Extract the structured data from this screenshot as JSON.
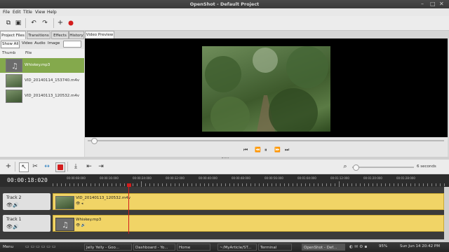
{
  "window": {
    "title": "OpenShot - Default Project"
  },
  "menu": [
    "File",
    "Edit",
    "Title",
    "View",
    "Help"
  ],
  "left_tabs": [
    "Project Files",
    "Transitions",
    "Effects",
    "History"
  ],
  "filters": [
    "Show All",
    "Video",
    "Audio",
    "Image"
  ],
  "columns": {
    "thumb": "Thumb",
    "file": "File"
  },
  "files": [
    {
      "name": "Whiskey.mp3",
      "kind": "audio",
      "selected": true
    },
    {
      "name": "VID_20140114_153740.m4v",
      "kind": "video",
      "selected": false
    },
    {
      "name": "VID_20140113_120532.m4v",
      "kind": "video",
      "selected": false
    }
  ],
  "preview_tab": "Video Preview",
  "zoom_label": "6 seconds",
  "timecode": "00:00:18:020",
  "ruler_ticks": [
    "00:00:08:000",
    "00:00:16:000",
    "00:00:24:000",
    "00:00:32:000",
    "00:00:40:000",
    "00:00:48:000",
    "00:00:56:000",
    "00:01:04:000",
    "00:01:12:000",
    "00:01:20:000",
    "00:01:28:000"
  ],
  "tracks": [
    {
      "name": "Track 2",
      "clip": "VID_20140113_120532.m4v",
      "clip_kind": "video"
    },
    {
      "name": "Track 1",
      "clip": "Whiskey.mp3",
      "clip_kind": "audio"
    }
  ],
  "taskbar": {
    "menu": "Menu",
    "tasks": [
      "Jelly Yelly - Goo...",
      "Dashboard - Yo...",
      "Home",
      "~/MyArticle/ST...",
      "Terminal",
      "OpenShot - Def..."
    ],
    "battery": "95%",
    "clock": "Sun Jun 14 20:42 PM"
  },
  "colors": {
    "selected": "#84a94c",
    "clip": "#f1d466",
    "playhead": "#d31c1c"
  }
}
